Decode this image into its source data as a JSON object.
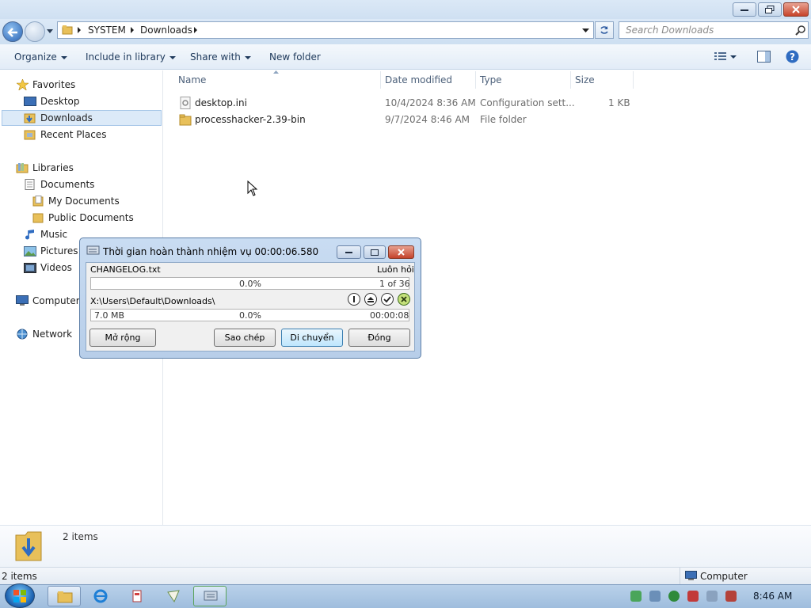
{
  "address": {
    "crumbs": [
      "SYSTEM",
      "Downloads"
    ],
    "search_placeholder": "Search Downloads"
  },
  "toolbar": {
    "organize": "Organize",
    "include_library": "Include in library",
    "share_with": "Share with",
    "new_folder": "New folder"
  },
  "nav": {
    "favorites": "Favorites",
    "desktop": "Desktop",
    "downloads": "Downloads",
    "recent_places": "Recent Places",
    "libraries": "Libraries",
    "documents": "Documents",
    "my_documents": "My Documents",
    "public_documents": "Public Documents",
    "music": "Music",
    "pictures": "Pictures",
    "videos": "Videos",
    "computer": "Computer",
    "network": "Network"
  },
  "columns": {
    "name": "Name",
    "date": "Date modified",
    "type": "Type",
    "size": "Size"
  },
  "files": [
    {
      "name": "desktop.ini",
      "date": "10/4/2024 8:36 AM",
      "type": "Configuration sett...",
      "size": "1 KB"
    },
    {
      "name": "processhacker-2.39-bin",
      "date": "9/7/2024 8:46 AM",
      "type": "File folder",
      "size": ""
    }
  ],
  "details": {
    "count": "2 items"
  },
  "status": {
    "left": "2 items",
    "right": "Computer"
  },
  "dialog": {
    "title": "Thời gian hoàn thành nhiệm vụ 00:00:06.580",
    "filename": "CHANGELOG.txt",
    "mode": "Luôn hỏi",
    "progress1": "0.0%",
    "counter": "1 of 36",
    "path": "X:\\Users\\Default\\Downloads\\",
    "size": "7.0 MB",
    "progress2": "0.0%",
    "remaining": "00:00:08",
    "expand_label": "Mở rộng",
    "copy_label": "Sao chép",
    "move_label": "Di chuyển",
    "close_label": "Đóng"
  },
  "taskbar": {
    "clock": "8:46 AM"
  },
  "colors": {
    "accent": "#3c7fb1",
    "selection": "#dceaf8",
    "folder": "#e8c05a"
  }
}
